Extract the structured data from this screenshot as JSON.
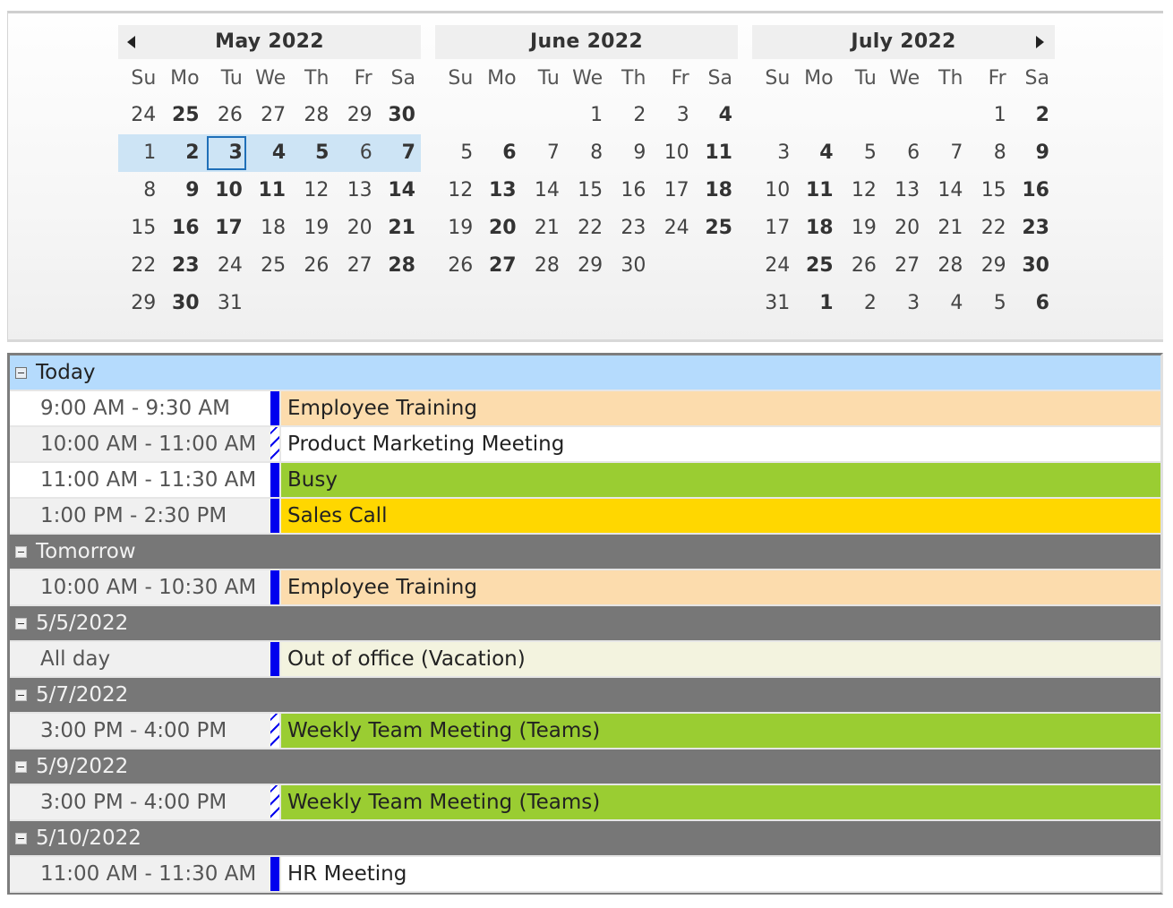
{
  "calendar": {
    "prev_label": "previous-month",
    "next_label": "next-month",
    "day_names": [
      "Su",
      "Mo",
      "Tu",
      "We",
      "Th",
      "Fr",
      "Sa"
    ],
    "months": [
      {
        "title": "May 2022",
        "weeks": [
          [
            {
              "d": "24",
              "b": false
            },
            {
              "d": "25",
              "b": true
            },
            {
              "d": "26",
              "b": false
            },
            {
              "d": "27",
              "b": false
            },
            {
              "d": "28",
              "b": false
            },
            {
              "d": "29",
              "b": false
            },
            {
              "d": "30",
              "b": true
            }
          ],
          [
            {
              "d": "1",
              "b": false
            },
            {
              "d": "2",
              "b": true
            },
            {
              "d": "3",
              "b": true,
              "today": true
            },
            {
              "d": "4",
              "b": true
            },
            {
              "d": "5",
              "b": true
            },
            {
              "d": "6",
              "b": false
            },
            {
              "d": "7",
              "b": true
            }
          ],
          [
            {
              "d": "8",
              "b": false
            },
            {
              "d": "9",
              "b": true
            },
            {
              "d": "10",
              "b": true
            },
            {
              "d": "11",
              "b": true
            },
            {
              "d": "12",
              "b": false
            },
            {
              "d": "13",
              "b": false
            },
            {
              "d": "14",
              "b": true
            }
          ],
          [
            {
              "d": "15",
              "b": false
            },
            {
              "d": "16",
              "b": true
            },
            {
              "d": "17",
              "b": true
            },
            {
              "d": "18",
              "b": false
            },
            {
              "d": "19",
              "b": false
            },
            {
              "d": "20",
              "b": false
            },
            {
              "d": "21",
              "b": true
            }
          ],
          [
            {
              "d": "22",
              "b": false
            },
            {
              "d": "23",
              "b": true
            },
            {
              "d": "24",
              "b": false
            },
            {
              "d": "25",
              "b": false
            },
            {
              "d": "26",
              "b": false
            },
            {
              "d": "27",
              "b": false
            },
            {
              "d": "28",
              "b": true
            }
          ],
          [
            {
              "d": "29",
              "b": false
            },
            {
              "d": "30",
              "b": true
            },
            {
              "d": "31",
              "b": false
            },
            {
              "d": "",
              "b": false
            },
            {
              "d": "",
              "b": false
            },
            {
              "d": "",
              "b": false
            },
            {
              "d": "",
              "b": false
            }
          ]
        ],
        "selected_week": 1
      },
      {
        "title": "June 2022",
        "weeks": [
          [
            {
              "d": "",
              "b": false
            },
            {
              "d": "",
              "b": false
            },
            {
              "d": "",
              "b": false
            },
            {
              "d": "1",
              "b": false
            },
            {
              "d": "2",
              "b": false
            },
            {
              "d": "3",
              "b": false
            },
            {
              "d": "4",
              "b": true
            }
          ],
          [
            {
              "d": "5",
              "b": false
            },
            {
              "d": "6",
              "b": true
            },
            {
              "d": "7",
              "b": false
            },
            {
              "d": "8",
              "b": false
            },
            {
              "d": "9",
              "b": false
            },
            {
              "d": "10",
              "b": false
            },
            {
              "d": "11",
              "b": true
            }
          ],
          [
            {
              "d": "12",
              "b": false
            },
            {
              "d": "13",
              "b": true
            },
            {
              "d": "14",
              "b": false
            },
            {
              "d": "15",
              "b": false
            },
            {
              "d": "16",
              "b": false
            },
            {
              "d": "17",
              "b": false
            },
            {
              "d": "18",
              "b": true
            }
          ],
          [
            {
              "d": "19",
              "b": false
            },
            {
              "d": "20",
              "b": true
            },
            {
              "d": "21",
              "b": false
            },
            {
              "d": "22",
              "b": false
            },
            {
              "d": "23",
              "b": false
            },
            {
              "d": "24",
              "b": false
            },
            {
              "d": "25",
              "b": true
            }
          ],
          [
            {
              "d": "26",
              "b": false
            },
            {
              "d": "27",
              "b": true
            },
            {
              "d": "28",
              "b": false
            },
            {
              "d": "29",
              "b": false
            },
            {
              "d": "30",
              "b": false
            },
            {
              "d": "",
              "b": false
            },
            {
              "d": "",
              "b": false
            }
          ],
          [
            {
              "d": "",
              "b": false
            },
            {
              "d": "",
              "b": false
            },
            {
              "d": "",
              "b": false
            },
            {
              "d": "",
              "b": false
            },
            {
              "d": "",
              "b": false
            },
            {
              "d": "",
              "b": false
            },
            {
              "d": "",
              "b": false
            }
          ]
        ],
        "selected_week": -1
      },
      {
        "title": "July 2022",
        "weeks": [
          [
            {
              "d": "",
              "b": false
            },
            {
              "d": "",
              "b": false
            },
            {
              "d": "",
              "b": false
            },
            {
              "d": "",
              "b": false
            },
            {
              "d": "",
              "b": false
            },
            {
              "d": "1",
              "b": false
            },
            {
              "d": "2",
              "b": true
            }
          ],
          [
            {
              "d": "3",
              "b": false
            },
            {
              "d": "4",
              "b": true
            },
            {
              "d": "5",
              "b": false
            },
            {
              "d": "6",
              "b": false
            },
            {
              "d": "7",
              "b": false
            },
            {
              "d": "8",
              "b": false
            },
            {
              "d": "9",
              "b": true
            }
          ],
          [
            {
              "d": "10",
              "b": false
            },
            {
              "d": "11",
              "b": true
            },
            {
              "d": "12",
              "b": false
            },
            {
              "d": "13",
              "b": false
            },
            {
              "d": "14",
              "b": false
            },
            {
              "d": "15",
              "b": false
            },
            {
              "d": "16",
              "b": true
            }
          ],
          [
            {
              "d": "17",
              "b": false
            },
            {
              "d": "18",
              "b": true
            },
            {
              "d": "19",
              "b": false
            },
            {
              "d": "20",
              "b": false
            },
            {
              "d": "21",
              "b": false
            },
            {
              "d": "22",
              "b": false
            },
            {
              "d": "23",
              "b": true
            }
          ],
          [
            {
              "d": "24",
              "b": false
            },
            {
              "d": "25",
              "b": true
            },
            {
              "d": "26",
              "b": false
            },
            {
              "d": "27",
              "b": false
            },
            {
              "d": "28",
              "b": false
            },
            {
              "d": "29",
              "b": false
            },
            {
              "d": "30",
              "b": true
            }
          ],
          [
            {
              "d": "31",
              "b": false
            },
            {
              "d": "1",
              "b": true
            },
            {
              "d": "2",
              "b": false
            },
            {
              "d": "3",
              "b": false
            },
            {
              "d": "4",
              "b": false
            },
            {
              "d": "5",
              "b": false
            },
            {
              "d": "6",
              "b": true
            }
          ]
        ],
        "selected_week": -1
      }
    ]
  },
  "agenda": {
    "colors": {
      "today_header": "#b5dbfd",
      "group_header": "#777777",
      "busy_bar": "#0000ee",
      "peach": "#fcdcad",
      "white": "#ffffff",
      "green": "#9acd32",
      "gold": "#ffd700",
      "beige": "#f5f5dc"
    },
    "groups": [
      {
        "title": "Today",
        "is_today": true,
        "items": [
          {
            "time": "9:00 AM - 9:30 AM",
            "subject": "Employee Training",
            "status": "busy",
            "color": "#fcdcad",
            "time_bg": "white"
          },
          {
            "time": "10:00 AM - 11:00 AM",
            "subject": "Product Marketing Meeting",
            "status": "tentative",
            "color": "#ffffff",
            "time_bg": "grey"
          },
          {
            "time": "11:00 AM - 11:30 AM",
            "subject": "Busy",
            "status": "busy",
            "color": "#9acd32",
            "time_bg": "white"
          },
          {
            "time": "1:00 PM - 2:30 PM",
            "subject": "Sales Call",
            "status": "busy",
            "color": "#ffd700",
            "time_bg": "grey"
          }
        ]
      },
      {
        "title": "Tomorrow",
        "is_today": false,
        "items": [
          {
            "time": "10:00 AM - 10:30 AM",
            "subject": "Employee Training",
            "status": "busy",
            "color": "#fcdcad",
            "time_bg": "grey"
          }
        ]
      },
      {
        "title": "5/5/2022",
        "is_today": false,
        "items": [
          {
            "time": "All day",
            "subject": "Out of office (Vacation)",
            "status": "busy",
            "color": "#f3f3df",
            "time_bg": "grey"
          }
        ]
      },
      {
        "title": "5/7/2022",
        "is_today": false,
        "items": [
          {
            "time": "3:00 PM - 4:00 PM",
            "subject": "Weekly Team Meeting (Teams)",
            "status": "tentative",
            "color": "#9acd32",
            "time_bg": "grey"
          }
        ]
      },
      {
        "title": "5/9/2022",
        "is_today": false,
        "items": [
          {
            "time": "3:00 PM - 4:00 PM",
            "subject": "Weekly Team Meeting (Teams)",
            "status": "tentative",
            "color": "#9acd32",
            "time_bg": "grey"
          }
        ]
      },
      {
        "title": "5/10/2022",
        "is_today": false,
        "items": [
          {
            "time": "11:00 AM - 11:30 AM",
            "subject": "HR Meeting",
            "status": "busy",
            "color": "#ffffff",
            "time_bg": "grey"
          }
        ]
      }
    ]
  }
}
